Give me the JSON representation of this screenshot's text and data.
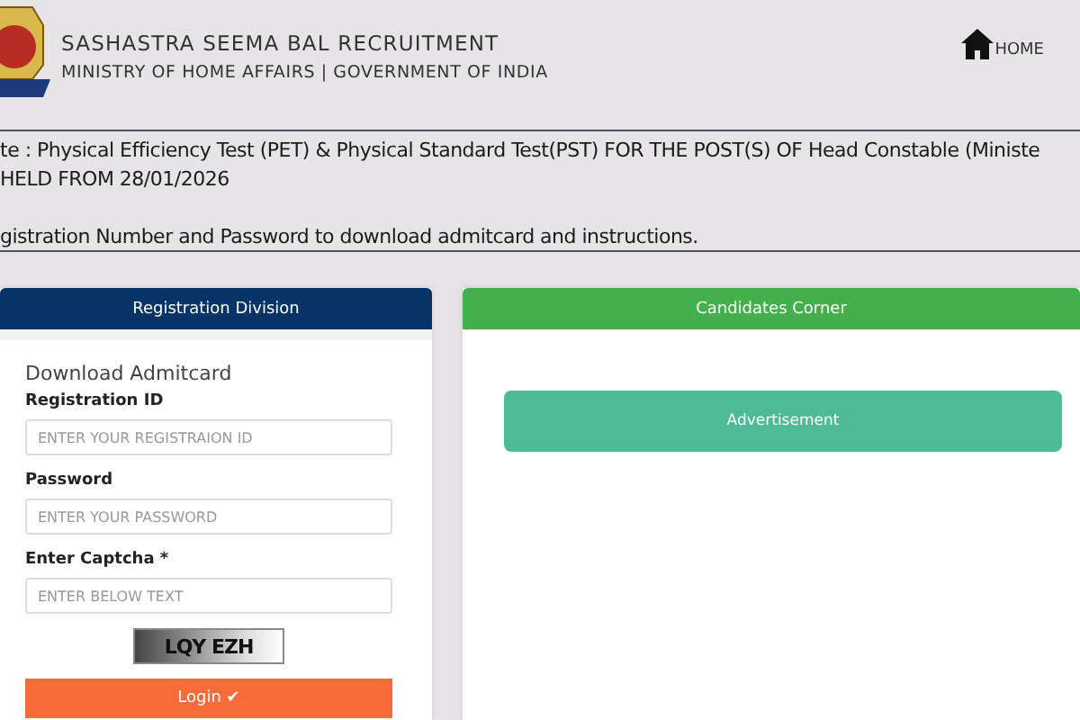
{
  "header": {
    "title": "SASHASTRA SEEMA BAL RECRUITMENT",
    "subtitle": "MINISTRY OF HOME AFFAIRS | GOVERNMENT OF INDIA",
    "home_link": "HOME"
  },
  "notice": {
    "lines": [
      "te : Physical Efficiency Test (PET) & Physical Standard Test(PST) FOR THE POST(S) OF Head Constable (Ministe",
      "HELD FROM 28/01/2026"
    ],
    "instruction": "gistration Number and Password to download admitcard and instructions."
  },
  "registration_panel": {
    "heading": "Registration Division",
    "form_title": "Download Admitcard",
    "fields": [
      {
        "label": "Registration ID",
        "placeholder": "ENTER YOUR REGISTRAION ID"
      },
      {
        "label": "Password",
        "placeholder": "ENTER YOUR PASSWORD"
      },
      {
        "label": "Enter Captcha *",
        "placeholder": "ENTER BELOW TEXT"
      }
    ],
    "captcha": "LQY EZH",
    "login_button": "Login ✔"
  },
  "candidates_panel": {
    "heading": "Candidates Corner",
    "advertisement": "Advertisement"
  }
}
